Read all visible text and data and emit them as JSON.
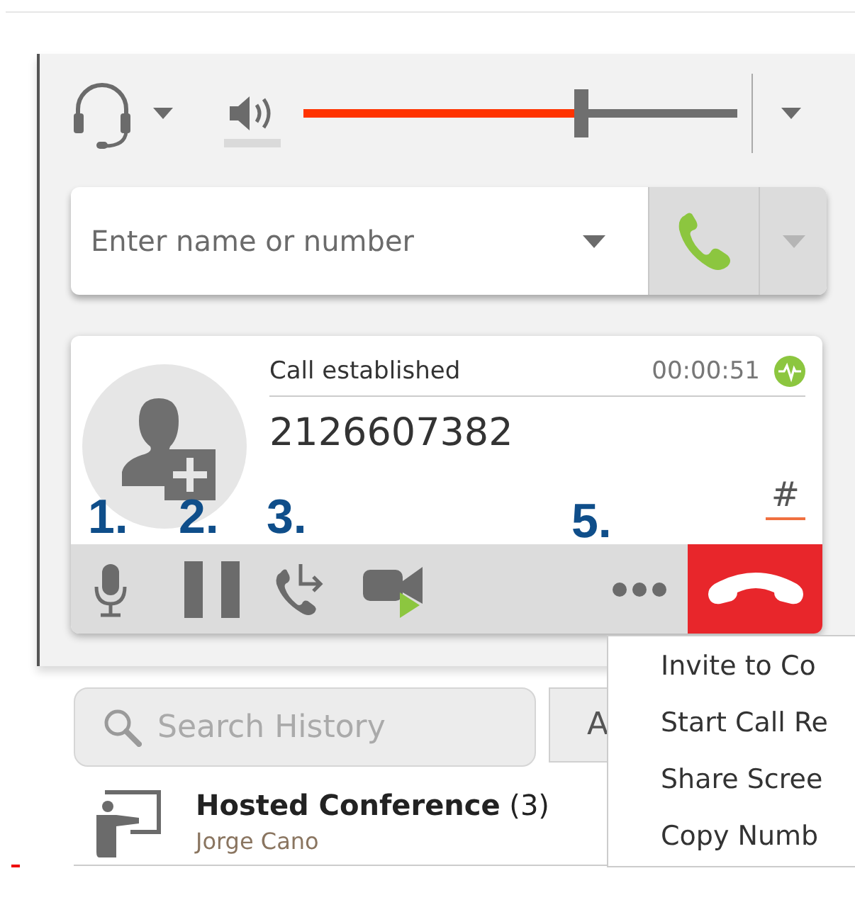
{
  "audio": {
    "volume": {
      "level": 0.64
    }
  },
  "dialer": {
    "placeholder": "Enter name or number"
  },
  "call": {
    "status": "Call established",
    "duration": "00:00:51",
    "number": "2126607382",
    "keypad": "#",
    "controls": [
      {
        "kind": "mute",
        "marker": "1."
      },
      {
        "kind": "hold",
        "marker": "2."
      },
      {
        "kind": "transfer",
        "marker": "3."
      },
      {
        "kind": "video"
      },
      {
        "kind": "more",
        "marker": "5."
      },
      {
        "kind": "hangup"
      }
    ]
  },
  "more_menu": {
    "items": [
      "Invite to Co",
      "Start Call Re",
      "Share Scree",
      "Copy Numb"
    ]
  },
  "history": {
    "search": {
      "placeholder": "Search History"
    },
    "filter_button": "A",
    "rows": [
      {
        "title": "**Hosted Conference** (3)",
        "subtitle": "Jorge Cano"
      }
    ]
  }
}
